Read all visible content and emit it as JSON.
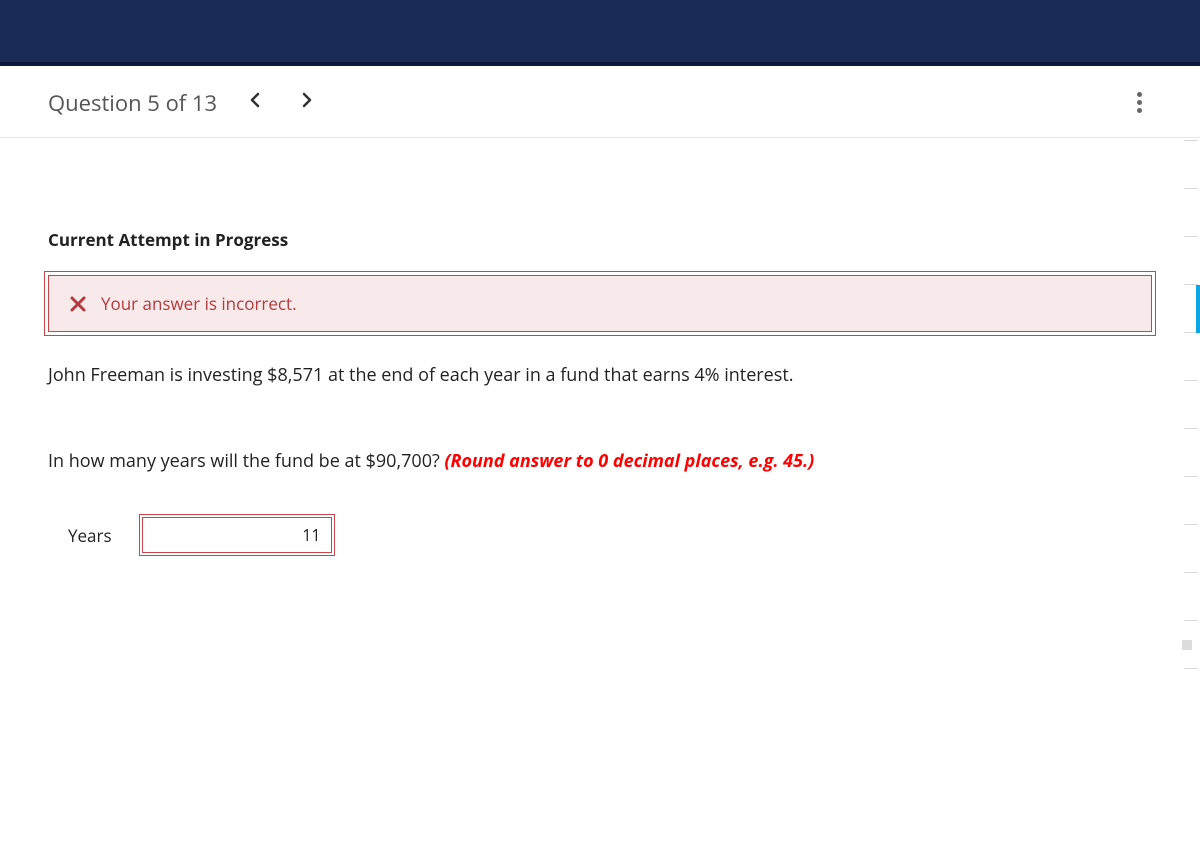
{
  "header": {
    "question_label": "Question 5 of 13"
  },
  "status": {
    "attempt_text": "Current Attempt in Progress"
  },
  "alert": {
    "message": "Your answer is incorrect."
  },
  "question": {
    "body": "John Freeman is investing $8,571 at the end of each year in a fund that earns 4% interest.",
    "prompt_prefix": "In how many years will the fund be at $90,700? ",
    "hint": "(Round answer to 0 decimal places, e.g. 45.)"
  },
  "answer": {
    "label": "Years",
    "value": "11"
  }
}
